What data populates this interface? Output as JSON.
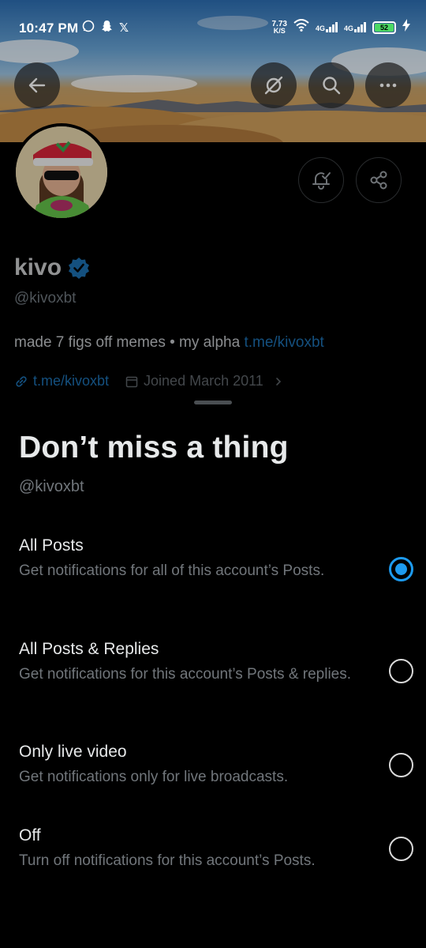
{
  "status_bar": {
    "time": "10:47 PM",
    "net_speed_value": "7.73",
    "net_speed_unit": "K/S",
    "sim1_label": "4G",
    "sim2_label": "4G",
    "battery_level": "52",
    "icons": [
      "whatsapp-icon",
      "snapchat-icon",
      "x-icon",
      "wifi-icon",
      "charging-icon"
    ]
  },
  "profile": {
    "display_name": "kivo",
    "handle": "@kivoxbt",
    "bio_text": "made 7 figs off memes • my alpha ",
    "bio_link": "t.me/kivoxbt",
    "website": "t.me/kivoxbt",
    "joined": "Joined March 2011",
    "verified": true
  },
  "sheet": {
    "title": "Don’t miss a thing",
    "handle": "@kivoxbt",
    "options": [
      {
        "title": "All Posts",
        "desc": "Get notifications for all of this account’s Posts.",
        "selected": true
      },
      {
        "title": "All Posts & Replies",
        "desc": "Get notifications for this account’s Posts & replies.",
        "selected": false
      },
      {
        "title": "Only live video",
        "desc": "Get notifications only for live broadcasts.",
        "selected": false
      },
      {
        "title": "Off",
        "desc": "Turn off notifications for this account’s Posts.",
        "selected": false
      }
    ]
  },
  "colors": {
    "accent": "#1d9bf0",
    "link": "#1d6fb0",
    "background": "#000000",
    "secondary_text": "#71767b"
  }
}
